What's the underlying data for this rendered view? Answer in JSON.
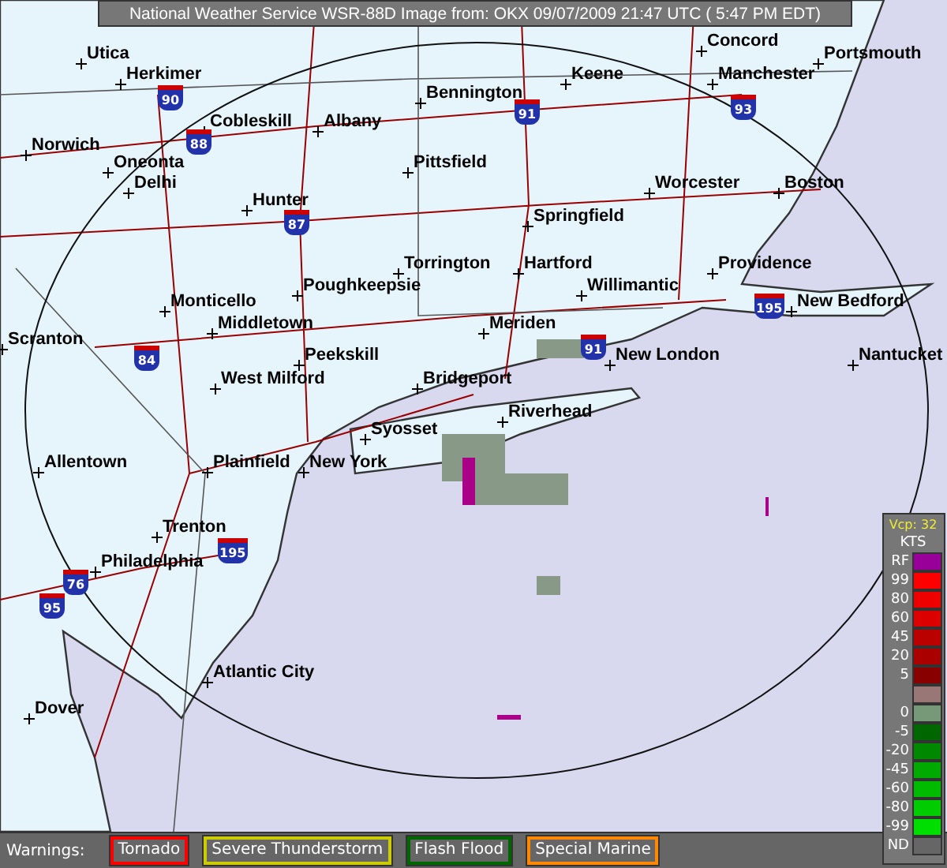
{
  "header": {
    "title": "National Weather Service WSR-88D Image from: OKX 09/07/2009 21:47 UTC ( 5:47 PM EDT)"
  },
  "map": {
    "cities": [
      {
        "name": "Concord"
      },
      {
        "name": "Utica"
      },
      {
        "name": "Portsmouth"
      },
      {
        "name": "Herkimer"
      },
      {
        "name": "Keene"
      },
      {
        "name": "Manchester"
      },
      {
        "name": "Bennington"
      },
      {
        "name": "Cobleskill"
      },
      {
        "name": "Albany"
      },
      {
        "name": "Norwich"
      },
      {
        "name": "Oneonta"
      },
      {
        "name": "Pittsfield"
      },
      {
        "name": "Delhi"
      },
      {
        "name": "Worcester"
      },
      {
        "name": "Boston"
      },
      {
        "name": "Hunter"
      },
      {
        "name": "Springfield"
      },
      {
        "name": "Torrington"
      },
      {
        "name": "Hartford"
      },
      {
        "name": "Providence"
      },
      {
        "name": "Poughkeepsie"
      },
      {
        "name": "Willimantic"
      },
      {
        "name": "Monticello"
      },
      {
        "name": "New Bedford"
      },
      {
        "name": "Middletown"
      },
      {
        "name": "Meriden"
      },
      {
        "name": "Scranton"
      },
      {
        "name": "Peekskill"
      },
      {
        "name": "New London"
      },
      {
        "name": "Nantucket"
      },
      {
        "name": "West Milford"
      },
      {
        "name": "Bridgeport"
      },
      {
        "name": "Riverhead"
      },
      {
        "name": "Syosset"
      },
      {
        "name": "Allentown"
      },
      {
        "name": "Plainfield"
      },
      {
        "name": "New York"
      },
      {
        "name": "Trenton"
      },
      {
        "name": "Philadelphia"
      },
      {
        "name": "Atlantic City"
      },
      {
        "name": "Dover"
      }
    ],
    "shields": [
      {
        "number": "90"
      },
      {
        "number": "91"
      },
      {
        "number": "93"
      },
      {
        "number": "88"
      },
      {
        "number": "87"
      },
      {
        "number": "195"
      },
      {
        "number": "84"
      },
      {
        "number": "91"
      },
      {
        "number": "195"
      },
      {
        "number": "76"
      },
      {
        "number": "95"
      }
    ]
  },
  "legend": {
    "mode": "Vcp: 32",
    "unit": "KTS",
    "entries": [
      {
        "label": "RF",
        "color": "#990099"
      },
      {
        "label": "99",
        "color": "#ff0000"
      },
      {
        "label": "80",
        "color": "#ee0000"
      },
      {
        "label": "60",
        "color": "#dd0000"
      },
      {
        "label": "45",
        "color": "#bb0000"
      },
      {
        "label": "20",
        "color": "#aa0000"
      },
      {
        "label": "5",
        "color": "#880000"
      },
      {
        "color": "#997777"
      },
      {
        "label": "0",
        "color": "#779977"
      },
      {
        "label": "-5",
        "color": "#006600"
      },
      {
        "label": "-20",
        "color": "#008800"
      },
      {
        "label": "-45",
        "color": "#00aa00"
      },
      {
        "label": "-60",
        "color": "#00bb00"
      },
      {
        "label": "-80",
        "color": "#00cc00"
      },
      {
        "label": "-99",
        "color": "#00dd00"
      },
      {
        "label": "ND",
        "color": "#666666"
      }
    ]
  },
  "warnings": {
    "label": "Warnings:",
    "items": [
      {
        "label": "Tornado",
        "color": "#ff0000"
      },
      {
        "label": "Severe Thunderstorm",
        "color": "#cccc00"
      },
      {
        "label": "Flash Flood",
        "color": "#006600"
      },
      {
        "label": "Special Marine",
        "color": "#ff8800"
      }
    ]
  }
}
